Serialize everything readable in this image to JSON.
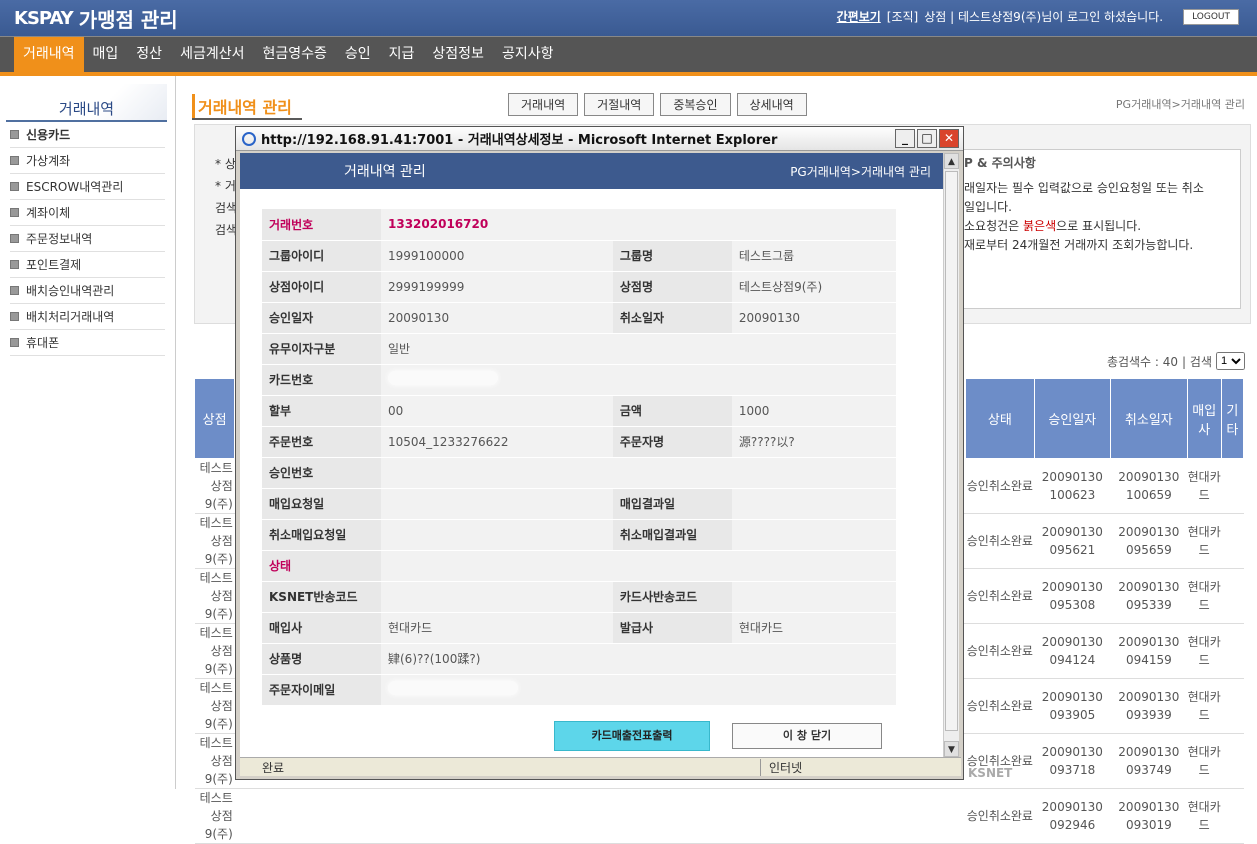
{
  "app": {
    "logo": "KSPAY",
    "title": "가맹점 관리"
  },
  "top": {
    "link": "간편보기",
    "role": "[조직]",
    "user_text": "상점 | 테스트상점9(주)님이 로그인 하셨습니다.",
    "logout": "LOGOUT"
  },
  "menu": [
    "거래내역",
    "매입",
    "정산",
    "세금계산서",
    "현금영수증",
    "승인",
    "지급",
    "상점정보",
    "공지사항"
  ],
  "sidebar": {
    "title": "거래내역",
    "items": [
      "신용카드",
      "가상계좌",
      "ESCROW내역관리",
      "계좌이체",
      "주문정보내역",
      "포인트결제",
      "배치승인내역관리",
      "배치처리거래내역",
      "휴대폰"
    ]
  },
  "content": {
    "title": "거래내역 관리",
    "tabs": [
      "거래내역",
      "거절내역",
      "중복승인",
      "상세내역"
    ],
    "crumb": "PG거래내역>거래내역 관리",
    "filter_lines": [
      "* 상",
      "* 거",
      "검색",
      "검색"
    ],
    "notice": {
      "heading": "P & 주의사항",
      "l1": "래일자는 필수 입력값으로 승인요청일 또는 취소",
      "l2": "일입니다.",
      "l3a": "소요청건은 ",
      "l3red": "붉은색",
      "l3b": "으로 표시됩니다.",
      "l4": "재로부터 24개월전 거래까지 조회가능합니다."
    },
    "count_label": "총검색수 : 40",
    "search_label": "| 검색",
    "page_value": "1",
    "headers": [
      "상점",
      "상태",
      "승인일자",
      "취소일자",
      "매입사",
      "기타"
    ],
    "rows": [
      {
        "shop": "테스트상점9(주)",
        "status": "승인취소완료",
        "ad": "20090130 100623",
        "cd": "20090130 100659",
        "acq": "현대카드"
      },
      {
        "shop": "테스트상점9(주)",
        "status": "승인취소완료",
        "ad": "20090130 095621",
        "cd": "20090130 095659",
        "acq": "현대카드"
      },
      {
        "shop": "테스트상점9(주)",
        "status": "승인취소완료",
        "ad": "20090130 095308",
        "cd": "20090130 095339",
        "acq": "현대카드"
      },
      {
        "shop": "테스트상점9(주)",
        "status": "승인취소완료",
        "ad": "20090130 094124",
        "cd": "20090130 094159",
        "acq": "현대카드"
      },
      {
        "shop": "테스트상점9(주)",
        "status": "승인취소완료",
        "ad": "20090130 093905",
        "cd": "20090130 093939",
        "acq": "현대카드"
      },
      {
        "shop": "테스트상점9(주)",
        "status": "승인취소완료",
        "ad": "20090130 093718",
        "cd": "20090130 093749",
        "acq": "현대카드"
      },
      {
        "shop": "테스트상점9(주)",
        "status": "승인취소완료",
        "ad": "20090130 092946",
        "cd": "20090130 093019",
        "acq": "현대카드"
      }
    ],
    "footer_logo": "KSNET"
  },
  "popup": {
    "window_title": "http://192.168.91.41:7001 - 거래내역상세정보 - Microsoft Internet Explorer",
    "header": "거래내역 관리",
    "crumb": "PG거래내역>거래내역 관리",
    "fields": {
      "trade_no_label": "거래번호",
      "trade_no": "133202016720",
      "group_id_label": "그룹아이디",
      "group_id": "1999100000",
      "group_name_label": "그룹명",
      "group_name": "테스트그룹",
      "shop_id_label": "상점아이디",
      "shop_id": "2999199999",
      "shop_name_label": "상점명",
      "shop_name": "테스트상점9(주)",
      "approve_date_label": "승인일자",
      "approve_date": "20090130",
      "cancel_date_label": "취소일자",
      "cancel_date": "20090130",
      "interest_label": "유무이자구분",
      "interest": "일반",
      "card_no_label": "카드번호",
      "installment_label": "할부",
      "installment": "00",
      "amount_label": "금액",
      "amount": "1000",
      "order_no_label": "주문번호",
      "order_no": "10504_1233276622",
      "orderer_label": "주문자명",
      "orderer": "源????以?",
      "approval_no_label": "승인번호",
      "buy_req_label": "매입요청일",
      "buy_result_label": "매입결과일",
      "cancel_buy_req_label": "취소매입요청일",
      "cancel_buy_result_label": "취소매입결과일",
      "status_label": "상태",
      "ksnet_code_label": "KSNET반송코드",
      "card_code_label": "카드사반송코드",
      "acquirer_label": "매입사",
      "acquirer": "현대카드",
      "issuer_label": "발급사",
      "issuer": "현대카드",
      "product_label": "상품명",
      "product": "肄(6)??(100蹂?)",
      "email_label": "주문자이메일"
    },
    "print_button": "카드매출전표출력",
    "close_button": "이 창 닫기",
    "status_done": "완료",
    "status_zone": "인터넷"
  }
}
